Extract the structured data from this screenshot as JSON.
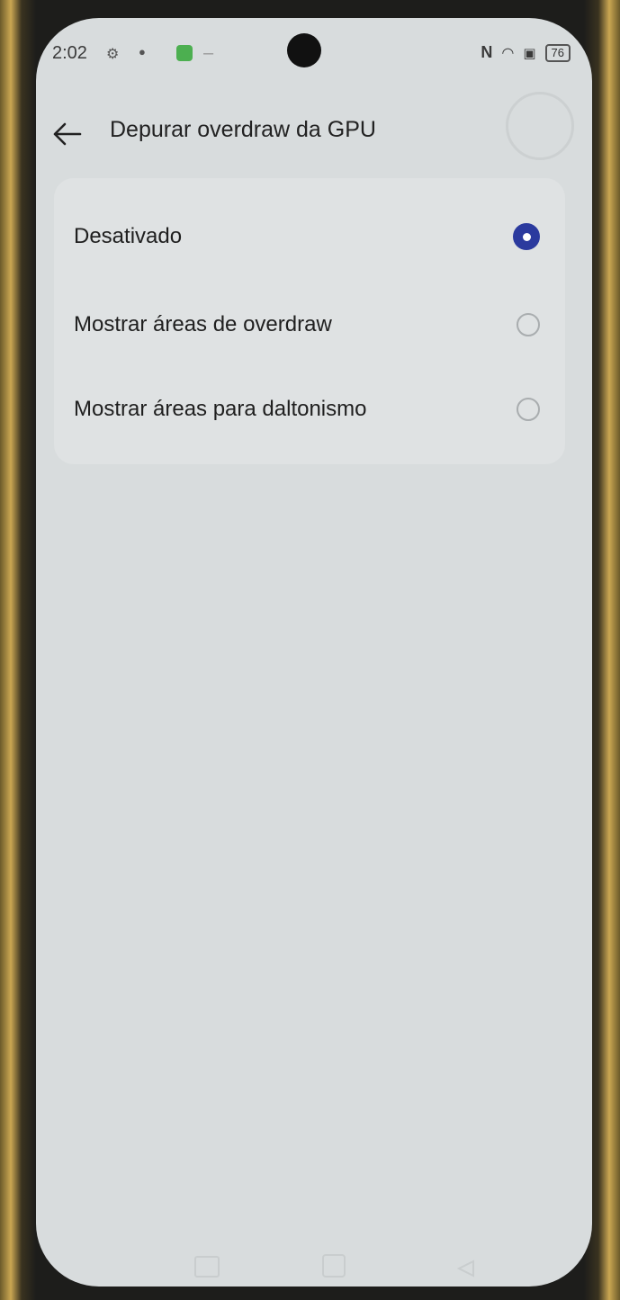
{
  "status_bar": {
    "time": "2:02",
    "battery": "76"
  },
  "header": {
    "title": "Depurar overdraw da GPU"
  },
  "options": [
    {
      "label": "Desativado",
      "selected": true
    },
    {
      "label": "Mostrar áreas de overdraw",
      "selected": false
    },
    {
      "label": "Mostrar áreas para daltonismo",
      "selected": false
    }
  ],
  "colors": {
    "accent": "#2b3a9e",
    "background": "#d8dcdd"
  },
  "icons": {
    "back": "arrow-left-icon"
  }
}
